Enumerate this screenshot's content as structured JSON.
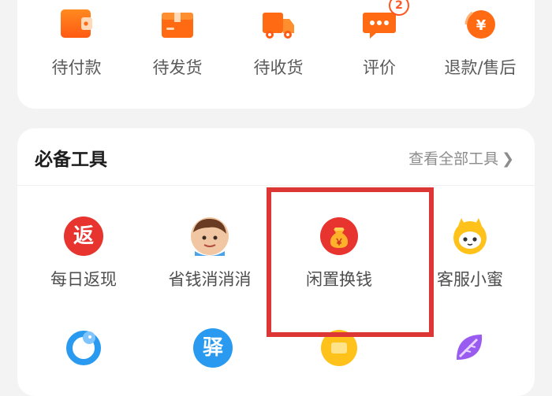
{
  "orders": {
    "items": [
      {
        "label": "待付款",
        "icon": "wallet-icon"
      },
      {
        "label": "待发货",
        "icon": "package-icon"
      },
      {
        "label": "待收货",
        "icon": "delivery-truck-icon"
      },
      {
        "label": "评价",
        "icon": "chat-bubble-icon",
        "badge": "2"
      },
      {
        "label": "退款/售后",
        "icon": "refund-icon"
      }
    ]
  },
  "tools": {
    "title": "必备工具",
    "view_all": "查看全部工具",
    "items": [
      {
        "label": "每日返现",
        "icon": "cashback-icon",
        "glyph": "返"
      },
      {
        "label": "省钱消消消",
        "icon": "cartoon-avatar-icon"
      },
      {
        "label": "闲置换钱",
        "icon": "money-bag-icon",
        "glyph": "￥"
      },
      {
        "label": "客服小蜜",
        "icon": "robot-face-icon"
      }
    ],
    "row2_glyph": "驿"
  },
  "colors": {
    "accent_orange": "#ff6a13",
    "badge_orange": "#ff5722",
    "red": "#e8342f",
    "blue": "#2a9af0",
    "yellow": "#ffc21a",
    "purple": "#9a5cf0",
    "highlight_red": "#dc3734"
  }
}
